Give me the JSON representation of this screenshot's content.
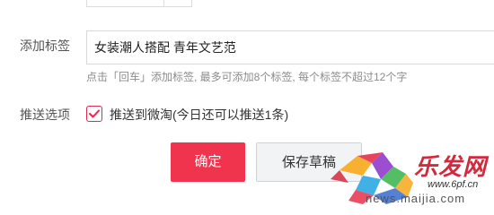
{
  "form": {
    "tags_label": "添加标签",
    "tags_value": "女装潮人搭配 青年文艺范",
    "tags_hint": "点击「回车」添加标签, 最多可添加8个标签, 每个标签不超过12个字",
    "push_label": "推送选项",
    "push_checkbox_label": "推送到微淘(今日还可以推送1条)",
    "push_checked": true
  },
  "actions": {
    "confirm_label": "确定",
    "save_draft_label": "保存草稿"
  },
  "watermark": {
    "brand": "乐发网",
    "url_primary": "www.6pf.cn",
    "url_secondary": "news.maijia.com"
  },
  "colors": {
    "accent": "#f0344e",
    "checkbox_border": "#e5294c",
    "hint_text": "#8c8c8c"
  }
}
